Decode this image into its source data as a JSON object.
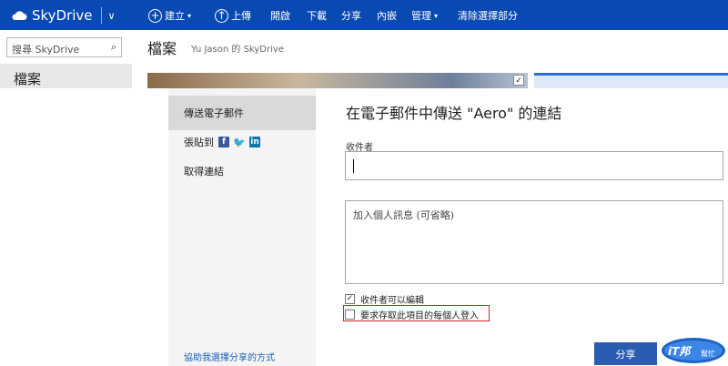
{
  "topbar": {
    "brand": "SkyDrive",
    "commands": {
      "create": "建立",
      "upload": "上傳",
      "open": "開啟",
      "download": "下載",
      "share": "分享",
      "embed": "內嵌",
      "manage": "管理",
      "clear_selection": "清除選擇部分"
    }
  },
  "sidebar": {
    "search_placeholder": "搜尋 SkyDrive",
    "files_label": "檔案"
  },
  "page": {
    "title": "檔案",
    "owner": "Yu Jason 的 SkyDrive"
  },
  "dialog": {
    "nav": {
      "send_email": "傳送電子郵件",
      "post_to": "張貼到",
      "get_link": "取得連結",
      "help_link": "協助我選擇分享的方式"
    },
    "title": "在電子郵件中傳送 \"Aero\" 的連結",
    "recipients_label": "收件者",
    "recipients_value": "",
    "message_placeholder": "加入個人訊息 (可省略)",
    "checkbox_can_edit": {
      "label": "收件者可以編輯",
      "checked": true
    },
    "checkbox_require_signin": {
      "label": "要求存取此項目的每個人登入",
      "checked": false
    },
    "share_button": "分享"
  },
  "watermark": {
    "text_main": "iT邦",
    "text_sub": "幫忙"
  },
  "colors": {
    "topbar": "#094ab2",
    "accent_button": "#2a5db0",
    "highlight_box": "#d32020",
    "link": "#1a5fb4"
  }
}
